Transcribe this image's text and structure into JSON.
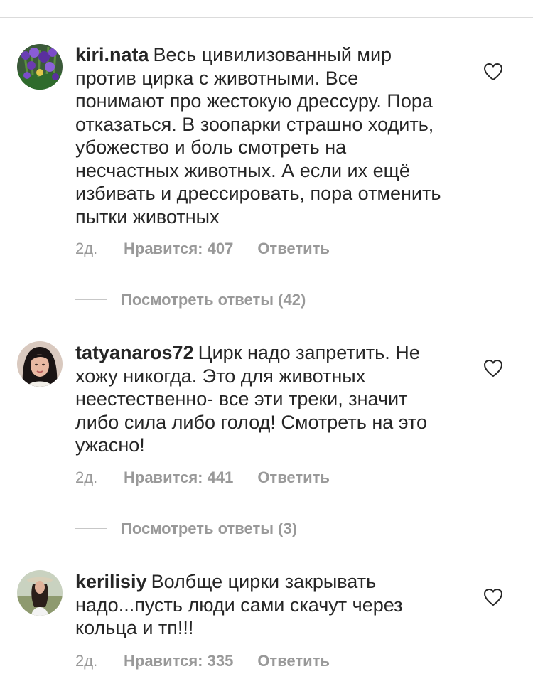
{
  "comments": [
    {
      "username": "kiri.nata",
      "text": "Весь цивилизованный мир против цирка с животными. Все понимают про жестокую дрессуру. Пора отказаться. В зоопарки страшно ходить, убожество и боль смотреть на несчастных животных. А если их ещё избивать и дрессировать, пора отменить пытки животных",
      "time": "2д.",
      "likes": "Нравится: 407",
      "reply": "Ответить",
      "view_replies": "Посмотреть ответы (42)"
    },
    {
      "username": "tatyanaros72",
      "text": "Цирк надо запретить. Не хожу никогда. Это для животных неестественно- все эти треки, значит либо сила либо голод! Смотреть на это ужасно!",
      "time": "2д.",
      "likes": "Нравится: 441",
      "reply": "Ответить",
      "view_replies": "Посмотреть ответы (3)"
    },
    {
      "username": "kerilisiy",
      "text": "Волбще цирки  закрывать надо...пусть люди сами скачут через кольца и тп!!!",
      "time": "2д.",
      "likes": "Нравится: 335",
      "reply": "Ответить"
    }
  ],
  "colors": {
    "text": "#262626",
    "secondary": "#999999",
    "divider": "#dbdbdb"
  },
  "icons": {
    "like": "heart-outline-icon"
  }
}
